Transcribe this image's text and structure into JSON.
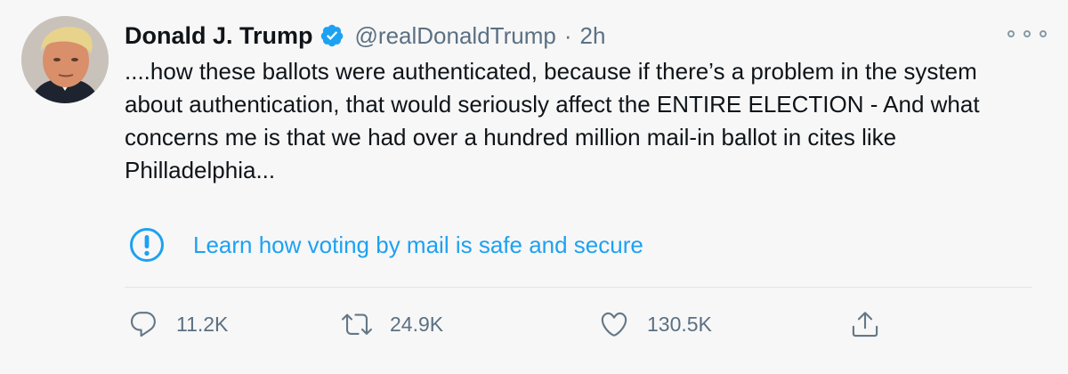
{
  "tweet": {
    "author": {
      "name": "Donald J. Trump",
      "handle": "@realDonaldTrump",
      "verified": true,
      "avatar": "profile-photo"
    },
    "separator": "·",
    "time": "2h",
    "more_icon": "more-options-icon",
    "body": "....how these ballots were authenticated, because if there’s a problem in the system about authentication, that would seriously affect the ENTIRE ELECTION - And what concerns me is that we had over a hundred million mail-in ballot in cites like Philladelphia...",
    "notice": {
      "icon": "exclamation-circle-icon",
      "text": "Learn how voting by mail is safe and secure"
    },
    "actions": {
      "reply": {
        "icon": "reply-icon",
        "count": "11.2K"
      },
      "retweet": {
        "icon": "retweet-icon",
        "count": "24.9K"
      },
      "like": {
        "icon": "heart-icon",
        "count": "130.5K"
      },
      "share": {
        "icon": "share-icon"
      }
    }
  },
  "colors": {
    "background": "#f7f7f7",
    "text": "#0f1419",
    "secondary": "#5b7083",
    "accent": "#1da1f2",
    "icon": "#657786"
  }
}
